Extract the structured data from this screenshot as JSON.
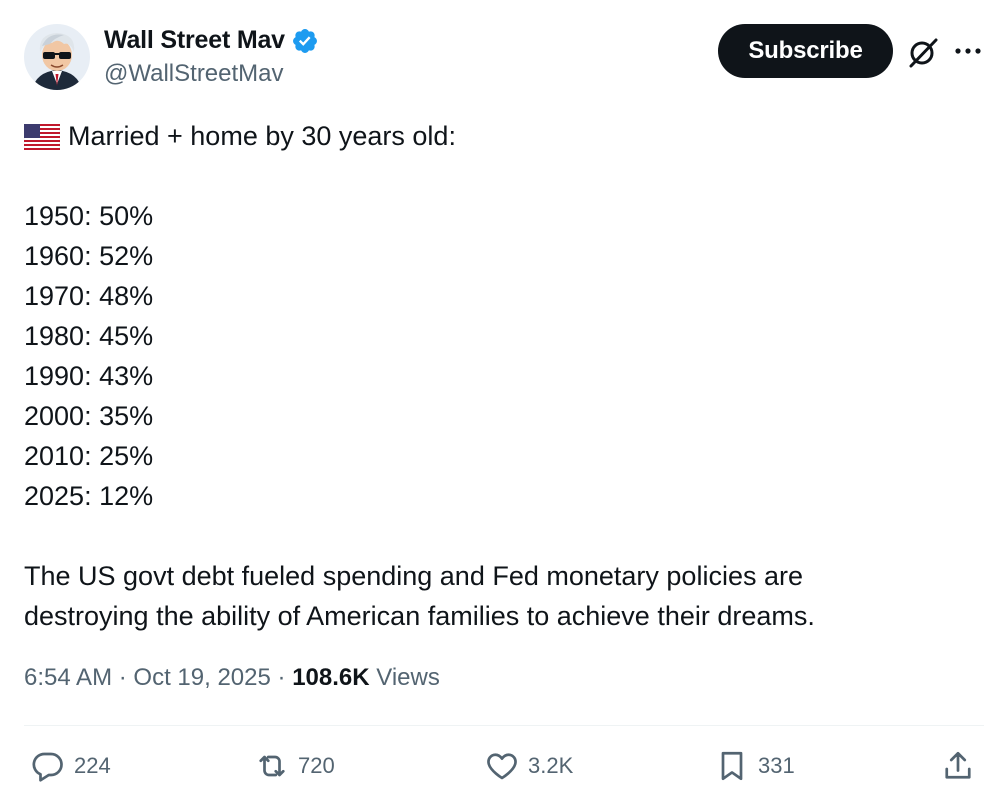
{
  "author": {
    "name": "Wall Street Mav",
    "handle": "@WallStreetMav",
    "verified_icon": "verified-badge-icon",
    "avatar_icon": "avatar-mascot"
  },
  "header": {
    "subscribe_label": "Subscribe",
    "grok_icon": "grok-icon",
    "more_icon": "more-icon"
  },
  "post": {
    "flag_icon": "us-flag-icon",
    "heading": "Married + home by 30 years old:",
    "stats": [
      "1950: 50%",
      "1960: 52%",
      "1970: 48%",
      "1980: 45%",
      "1990: 43%",
      "2000: 35%",
      "2010: 25%",
      "2025: 12%"
    ],
    "body_lines": [
      "The US govt debt fueled spending and Fed monetary policies are",
      "destroying the ability of American families to achieve their dreams."
    ]
  },
  "meta": {
    "time": "6:54 AM",
    "date": "Oct 19, 2025",
    "separator": "·",
    "views_count": "108.6K",
    "views_label": "Views"
  },
  "actions": {
    "replies": "224",
    "reposts": "720",
    "likes": "3.2K",
    "bookmarks": "331"
  },
  "colors": {
    "text": "#0f1419",
    "secondary": "#536471",
    "verified": "#1d9bf0",
    "button_bg": "#0f1419"
  }
}
